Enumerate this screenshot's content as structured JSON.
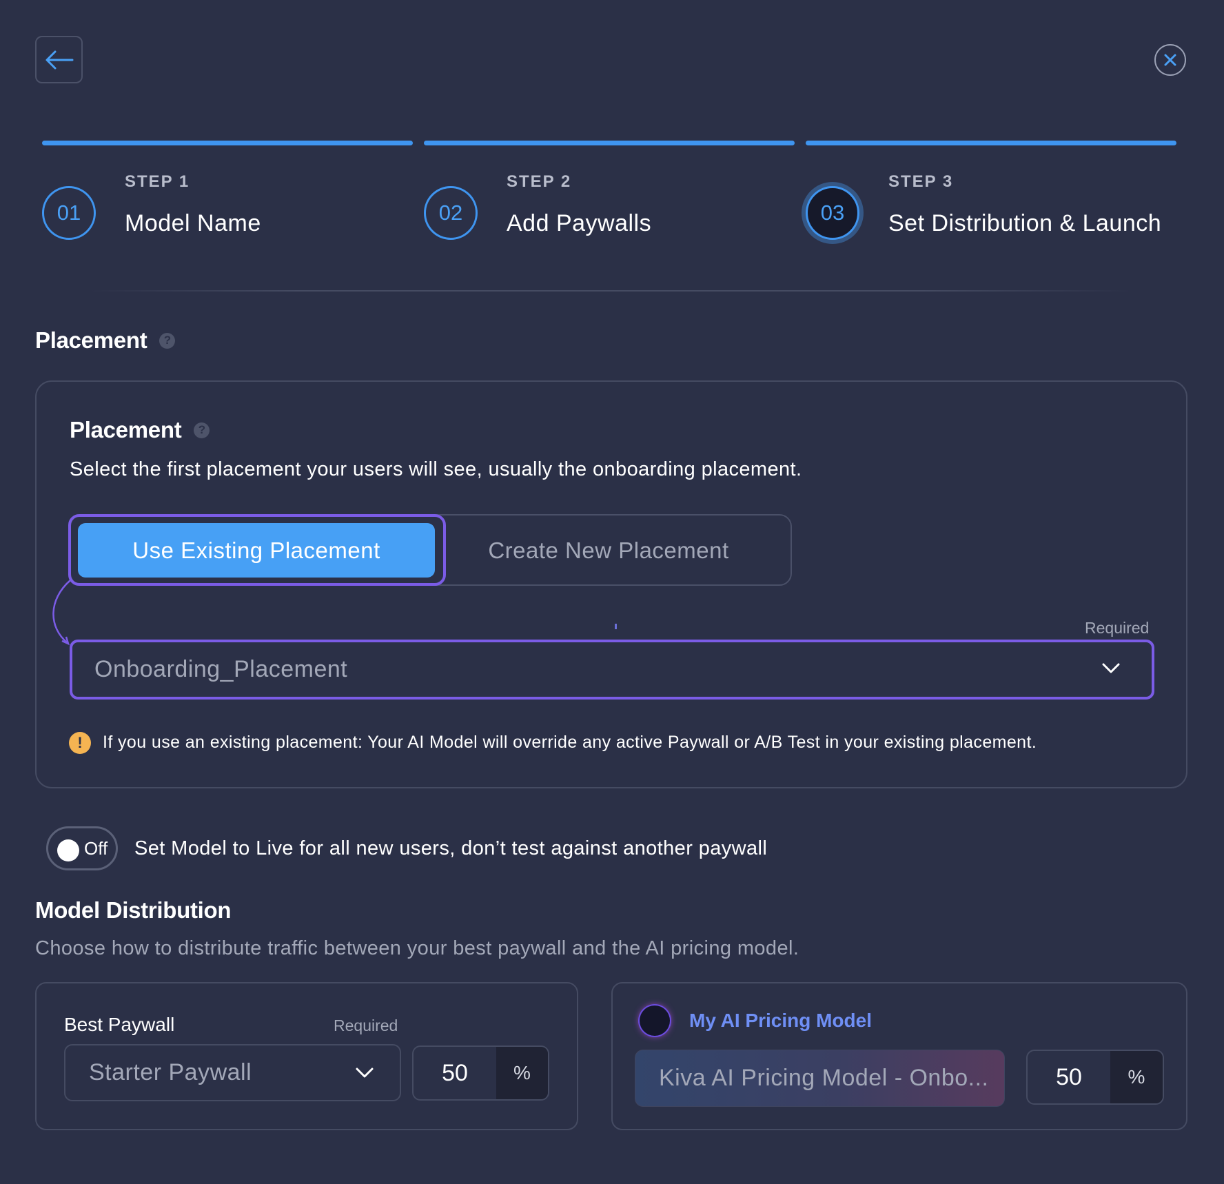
{
  "steps": [
    {
      "number": "01",
      "kicker": "STEP 1",
      "title": "Model Name"
    },
    {
      "number": "02",
      "kicker": "STEP 2",
      "title": "Add Paywalls"
    },
    {
      "number": "03",
      "kicker": "STEP 3",
      "title": "Set Distribution & Launch"
    }
  ],
  "placement_section": {
    "heading": "Placement",
    "help_glyph": "?",
    "card": {
      "title": "Placement",
      "description": "Select the first placement your users will see, usually the onboarding placement.",
      "options": {
        "existing": "Use Existing Placement",
        "new": "Create New Placement"
      },
      "required_label": "Required",
      "selected_placement": "Onboarding_Placement",
      "warning_glyph": "!",
      "warning": "If you use an existing placement: Your AI Model will override any active Paywall or A/B Test in your existing placement."
    }
  },
  "live_toggle": {
    "state": "Off",
    "label": "Set Model to Live for all new users, don’t test against another paywall"
  },
  "distribution": {
    "heading": "Model Distribution",
    "description": "Choose how to distribute traffic between your best paywall and the AI pricing model.",
    "best_paywall": {
      "label": "Best Paywall",
      "required": "Required",
      "value": "Starter Paywall",
      "percent": "50",
      "percent_symbol": "%"
    },
    "ai_model": {
      "label": "My AI Pricing Model",
      "value": "Kiva AI Pricing Model - Onbo...",
      "percent": "50",
      "percent_symbol": "%"
    }
  },
  "colors": {
    "background": "#2b3047",
    "accent": "#3f95f0",
    "focus": "#7b5ce6",
    "warning": "#f5b452"
  }
}
